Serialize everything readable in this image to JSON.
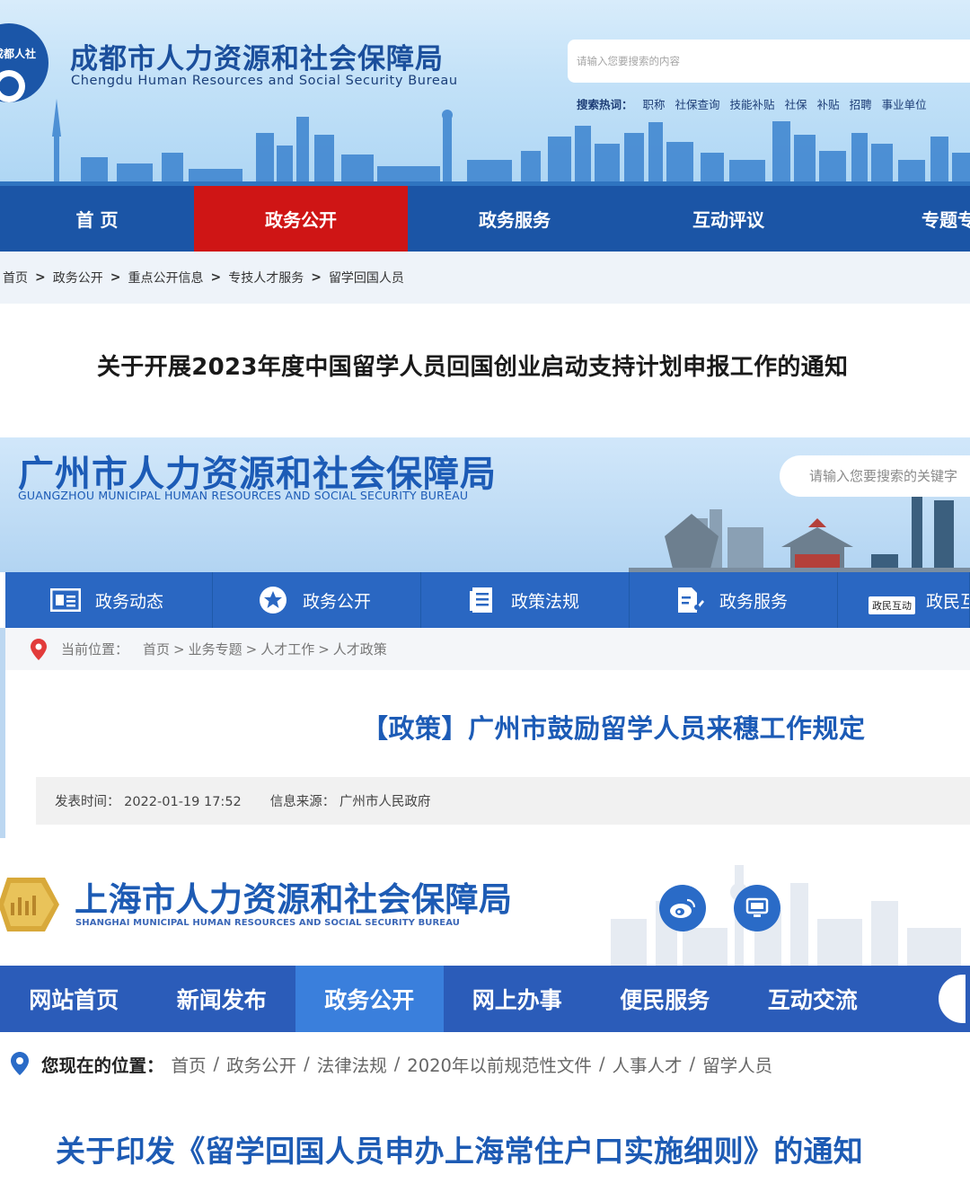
{
  "chengdu": {
    "logo_text": "成都人社",
    "title": "成都市人力资源和社会保障局",
    "subtitle": "Chengdu Human Resources and Social Security Bureau",
    "search_placeholder": "请输入您要搜索的内容",
    "hot_label": "搜索热词：",
    "hot_terms": [
      "职称",
      "社保查询",
      "技能补贴",
      "社保",
      "补贴",
      "招聘",
      "事业单位"
    ],
    "nav": [
      "首 页",
      "政务公开",
      "政务服务",
      "互动评议",
      "专题专栏"
    ],
    "nav_active_index": 1,
    "breadcrumb": [
      "首页",
      "政务公开",
      "重点公开信息",
      "专技人才服务",
      "留学回国人员"
    ],
    "breadcrumb_sep": ">",
    "article_title": "关于开展2023年度中国留学人员回国创业启动支持计划申报工作的通知",
    "colors": {
      "nav_bg": "#1b55a6",
      "nav_active": "#cf1515",
      "title": "#1b4f9c"
    }
  },
  "guangzhou": {
    "title": "广州市人力资源和社会保障局",
    "subtitle": "GUANGZHOU MUNICIPAL HUMAN RESOURCES AND SOCIAL SECURITY BUREAU",
    "search_placeholder": "请输入您要搜索的关键字",
    "nav": [
      {
        "label": "政务动态",
        "icon": "newspaper-icon"
      },
      {
        "label": "政务公开",
        "icon": "star-badge-icon"
      },
      {
        "label": "政策法规",
        "icon": "document-icon"
      },
      {
        "label": "政务服务",
        "icon": "form-edit-icon"
      },
      {
        "label": "政民互动",
        "icon": "interaction-badge-icon",
        "badge": "政民互动"
      }
    ],
    "breadcrumb_label": "当前位置：",
    "breadcrumb": [
      "首页",
      "业务专题",
      "人才工作",
      "人才政策"
    ],
    "breadcrumb_sep": ">",
    "article_title": "【政策】广州市鼓励留学人员来穗工作规定",
    "meta": {
      "publish_label": "发表时间：",
      "publish_time": "2022-01-19 17:52",
      "source_label": "信息来源：",
      "source": "广州市人民政府"
    },
    "colors": {
      "nav_bg": "#2a67c2",
      "title": "#1c5bb6"
    }
  },
  "shanghai": {
    "title": "上海市人力资源和社会保障局",
    "subtitle": "SHANGHAI MUNICIPAL HUMAN RESOURCES AND SOCIAL SECURITY BUREAU",
    "header_icons": [
      "weibo-icon",
      "monitor-icon"
    ],
    "nav": [
      "网站首页",
      "新闻发布",
      "政务公开",
      "网上办事",
      "便民服务",
      "互动交流"
    ],
    "nav_active_index": 2,
    "breadcrumb_label": "您现在的位置：",
    "breadcrumb": [
      "首页",
      "政务公开",
      "法律法规",
      "2020年以前规范性文件",
      "人事人才",
      "留学人员"
    ],
    "breadcrumb_sep": "/",
    "article_title": "关于印发《留学回国人员申办上海常住户口实施细则》的通知",
    "colors": {
      "nav_bg": "#2b5cb9",
      "nav_active": "#3a7fdc",
      "title": "#1d5bb4"
    }
  }
}
